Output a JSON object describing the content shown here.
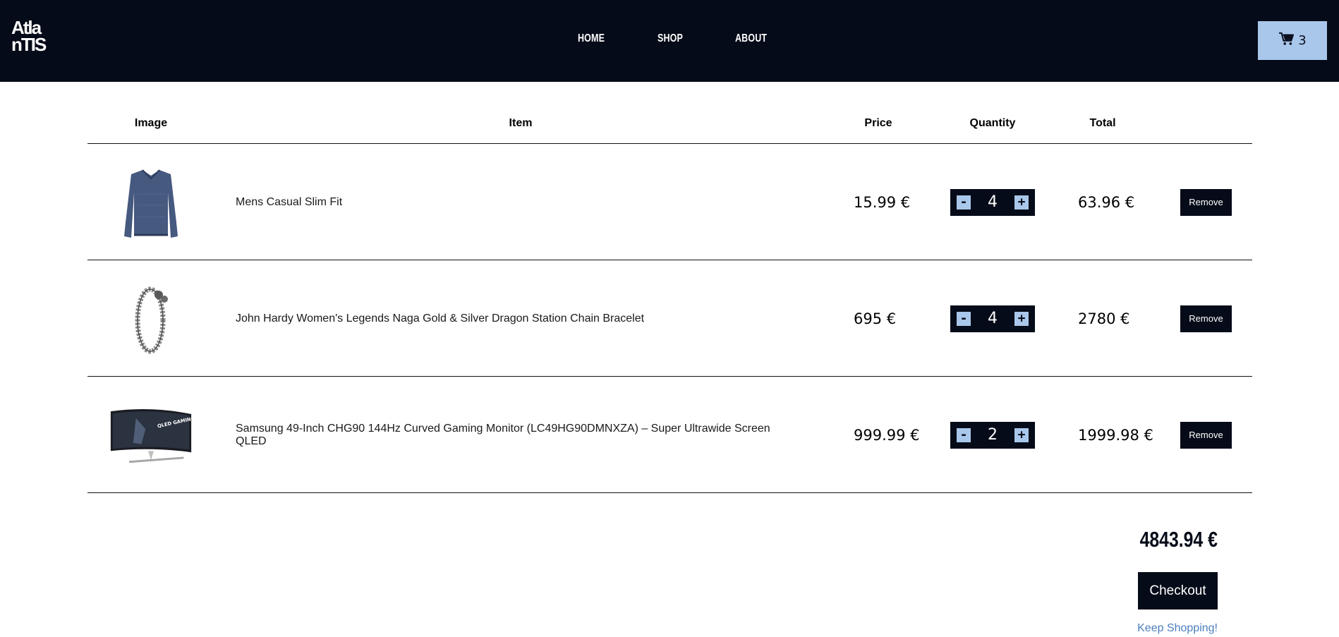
{
  "brand": {
    "logo_line1": "Atla",
    "logo_line2": "nTIS"
  },
  "nav": {
    "home": "HOME",
    "shop": "SHOP",
    "about": "ABOUT"
  },
  "cart": {
    "count": "3",
    "icon": "shopping-cart-icon"
  },
  "table": {
    "headers": {
      "image": "Image",
      "item": "Item",
      "price": "Price",
      "quantity": "Quantity",
      "total": "Total"
    },
    "rows": [
      {
        "image": "sweater-image",
        "item": "Mens Casual Slim Fit",
        "price": "15.99 €",
        "quantity": "4",
        "total": "63.96 €",
        "remove_label": "Remove"
      },
      {
        "image": "bracelet-image",
        "item": "John Hardy Women's Legends Naga Gold & Silver Dragon Station Chain Bracelet",
        "price": "695 €",
        "quantity": "4",
        "total": "2780 €",
        "remove_label": "Remove"
      },
      {
        "image": "monitor-image",
        "item": "Samsung 49-Inch CHG90 144Hz Curved Gaming Monitor (LC49HG90DMNXZA) – Super Ultrawide Screen QLED",
        "price": "999.99 €",
        "quantity": "2",
        "total": "1999.98 €",
        "remove_label": "Remove"
      }
    ],
    "minus_label": "-",
    "plus_label": "+"
  },
  "summary": {
    "grand_total": "4843.94 €",
    "checkout_label": "Checkout",
    "keep_shopping_label": "Keep Shopping!"
  },
  "colors": {
    "header_bg": "#050b18",
    "accent": "#a9c7ea",
    "link": "#4d7fbf"
  },
  "monitor_screen_text": "QLED GAMING MONITOR"
}
